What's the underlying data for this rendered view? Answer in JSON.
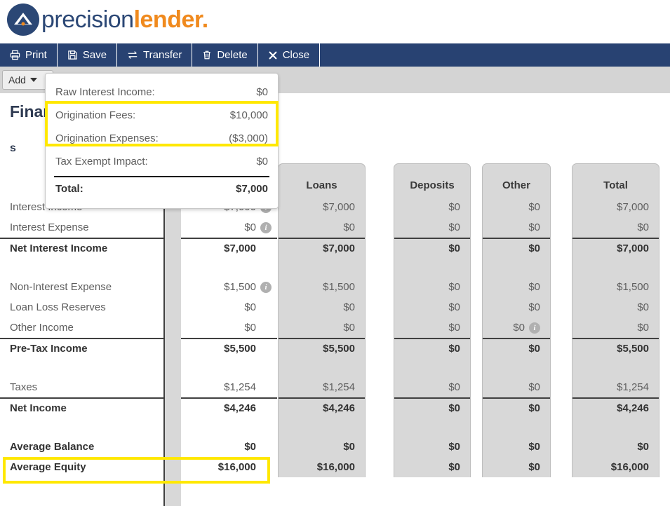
{
  "brand": {
    "name_part1": "precision",
    "name_part2": "lender",
    "name_part3": ".",
    "navy": "#284272",
    "orange": "#f08a1e"
  },
  "toolbar": {
    "buttons": [
      {
        "label": "Print",
        "icon": "printer-icon"
      },
      {
        "label": "Save",
        "icon": "floppy-disk-icon"
      },
      {
        "label": "Transfer",
        "icon": "transfer-arrows-icon"
      },
      {
        "label": "Delete",
        "icon": "trash-icon"
      },
      {
        "label": "Close",
        "icon": "close-x-icon"
      }
    ]
  },
  "subbar": {
    "add_label": "Add",
    "add_caret": "chevron-down-icon"
  },
  "page": {
    "title": "Financial",
    "subheading": "s"
  },
  "popup": {
    "rows": [
      {
        "label": "Raw Interest Income:",
        "value": "$0"
      },
      {
        "label": "Origination Fees:",
        "value": "$10,000"
      },
      {
        "label": "Origination Expenses:",
        "value": "($3,000)"
      },
      {
        "label": "Tax Exempt Impact:",
        "value": "$0"
      }
    ],
    "total_label": "Total:",
    "total_value": "$7,000"
  },
  "chart_data": {
    "type": "table",
    "title": "Financials",
    "columns": [
      "",
      "",
      "Loans",
      "Deposits",
      "Other",
      "Total"
    ],
    "column_headers": [
      "Loans",
      "Deposits",
      "Other",
      "Total"
    ],
    "rows": [
      {
        "label": "Interest Income",
        "bold": false,
        "topline": false,
        "primary": "$7,000",
        "primary_info": true,
        "loans": "$7,000",
        "deposits": "$0",
        "other": "$0",
        "other_info": false,
        "total": "$7,000"
      },
      {
        "label": "Interest Expense",
        "bold": false,
        "topline": false,
        "primary": "$0",
        "primary_info": true,
        "loans": "$0",
        "deposits": "$0",
        "other": "$0",
        "other_info": false,
        "total": "$0"
      },
      {
        "label": "Net Interest Income",
        "bold": true,
        "topline": true,
        "primary": "$7,000",
        "primary_info": false,
        "loans": "$7,000",
        "deposits": "$0",
        "other": "$0",
        "other_info": false,
        "total": "$7,000"
      },
      {
        "label": "Non-Interest Expense",
        "bold": false,
        "topline": false,
        "primary": "$1,500",
        "primary_info": true,
        "loans": "$1,500",
        "deposits": "$0",
        "other": "$0",
        "other_info": false,
        "total": "$1,500"
      },
      {
        "label": "Loan Loss Reserves",
        "bold": false,
        "topline": false,
        "primary": "$0",
        "primary_info": false,
        "loans": "$0",
        "deposits": "$0",
        "other": "$0",
        "other_info": false,
        "total": "$0"
      },
      {
        "label": "Other Income",
        "bold": false,
        "topline": false,
        "primary": "$0",
        "primary_info": false,
        "loans": "$0",
        "deposits": "$0",
        "other": "$0",
        "other_info": true,
        "total": "$0"
      },
      {
        "label": "Pre-Tax Income",
        "bold": true,
        "topline": true,
        "primary": "$5,500",
        "primary_info": false,
        "loans": "$5,500",
        "deposits": "$0",
        "other": "$0",
        "other_info": false,
        "total": "$5,500"
      },
      {
        "label": "Taxes",
        "bold": false,
        "topline": false,
        "primary": "$1,254",
        "primary_info": false,
        "loans": "$1,254",
        "deposits": "$0",
        "other": "$0",
        "other_info": false,
        "total": "$1,254"
      },
      {
        "label": "Net Income",
        "bold": true,
        "topline": true,
        "primary": "$4,246",
        "primary_info": false,
        "loans": "$4,246",
        "deposits": "$0",
        "other": "$0",
        "other_info": false,
        "total": "$4,246"
      },
      {
        "label": "Average Balance",
        "bold": true,
        "topline": false,
        "primary": "$0",
        "primary_info": false,
        "loans": "$0",
        "deposits": "$0",
        "other": "$0",
        "other_info": false,
        "total": "$0"
      },
      {
        "label": "Average Equity",
        "bold": true,
        "topline": false,
        "primary": "$16,000",
        "primary_info": false,
        "loans": "$16,000",
        "deposits": "$0",
        "other": "$0",
        "other_info": false,
        "total": "$16,000"
      }
    ]
  },
  "highlights": {
    "accent_color": "#ffe800",
    "popup_rows": [
      "Origination Fees:",
      "Origination Expenses:"
    ],
    "table_row": "Average Balance"
  }
}
